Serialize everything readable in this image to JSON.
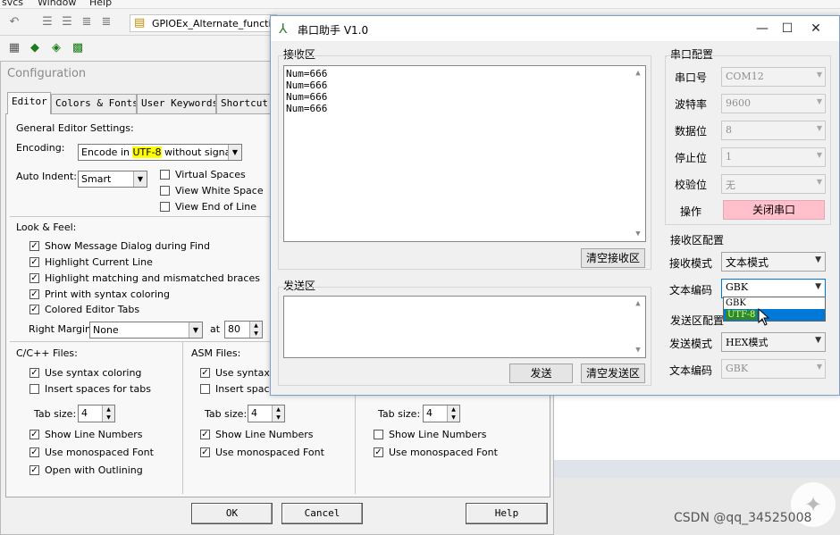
{
  "ide": {
    "menu": [
      "svcs",
      "Window",
      "Help"
    ],
    "tab_label": "GPIOEx_Alternate_function"
  },
  "watermarks": {
    "csdn": "CSDN @qq_34525008"
  },
  "config": {
    "title": "Configuration",
    "tabs": [
      "Editor",
      "Colors & Fonts",
      "User Keywords",
      "Shortcut K"
    ],
    "general": {
      "heading": "General Editor Settings:",
      "encoding_label": "Encoding:",
      "encoding_pre": "Encode in ",
      "encoding_hl": "UTF-8",
      "encoding_post": " without signature",
      "auto_indent_label": "Auto Indent:",
      "auto_indent_value": "Smart",
      "virtual_spaces": "Virtual Spaces",
      "view_white_space": "View White Space",
      "view_end_of_line": "View End of Line"
    },
    "look_feel": {
      "heading": "Look & Feel:",
      "items": [
        "Show Message Dialog during Find",
        "Highlight Current Line",
        "Highlight matching and mismatched braces",
        "Print with syntax coloring",
        "Colored Editor Tabs"
      ],
      "right_margin_label": "Right Margin:",
      "right_margin_value": "None",
      "at_label": "at",
      "at_value": "80"
    },
    "files": {
      "c": {
        "heading": "C/C++ Files:",
        "syntax": "Use syntax coloring",
        "insert_spaces": "Insert spaces for tabs",
        "tab_size_label": "Tab size:",
        "tab_size": "4",
        "line_numbers": "Show Line Numbers",
        "mono_font": "Use monospaced Font",
        "outlining": "Open with Outlining"
      },
      "asm": {
        "heading": "ASM Files:",
        "syntax": "Use syntax co",
        "insert_spaces": "Insert spaces",
        "tab_size_label": "Tab size:",
        "tab_size": "4",
        "line_numbers": "Show Line Numbers",
        "mono_font": "Use monospaced Font"
      },
      "other": {
        "tab_size_label": "Tab size:",
        "tab_size": "4",
        "line_numbers": "Show Line Numbers",
        "mono_font": "Use monospaced Font"
      }
    },
    "buttons": {
      "ok": "OK",
      "cancel": "Cancel",
      "help": "Help"
    }
  },
  "serial": {
    "title": "串口助手 V1.0",
    "receive": {
      "title": "接收区",
      "lines": [
        "Num=666",
        "Num=666",
        "Num=666",
        "Num=666"
      ],
      "clear_button": "清空接收区"
    },
    "send": {
      "title": "发送区",
      "send_button": "发送",
      "clear_button": "清空发送区"
    },
    "port_config": {
      "title": "串口配置",
      "port_label": "串口号",
      "port_value": "COM12",
      "baud_label": "波特率",
      "baud_value": "9600",
      "databits_label": "数据位",
      "databits_value": "8",
      "stopbits_label": "停止位",
      "stopbits_value": "1",
      "parity_label": "校验位",
      "parity_value": "无",
      "operation_label": "操作",
      "operation_button": "关闭串口"
    },
    "recv_config": {
      "title": "接收区配置",
      "mode_label": "接收模式",
      "mode_value": "文本模式",
      "encoding_label": "文本编码",
      "encoding_value": "GBK",
      "encoding_options": [
        "GBK",
        "UTF-8"
      ]
    },
    "send_config": {
      "title": "发送区配置",
      "mode_label": "发送模式",
      "mode_value": "HEX模式",
      "encoding_label": "文本编码",
      "encoding_value": "GBK"
    }
  }
}
